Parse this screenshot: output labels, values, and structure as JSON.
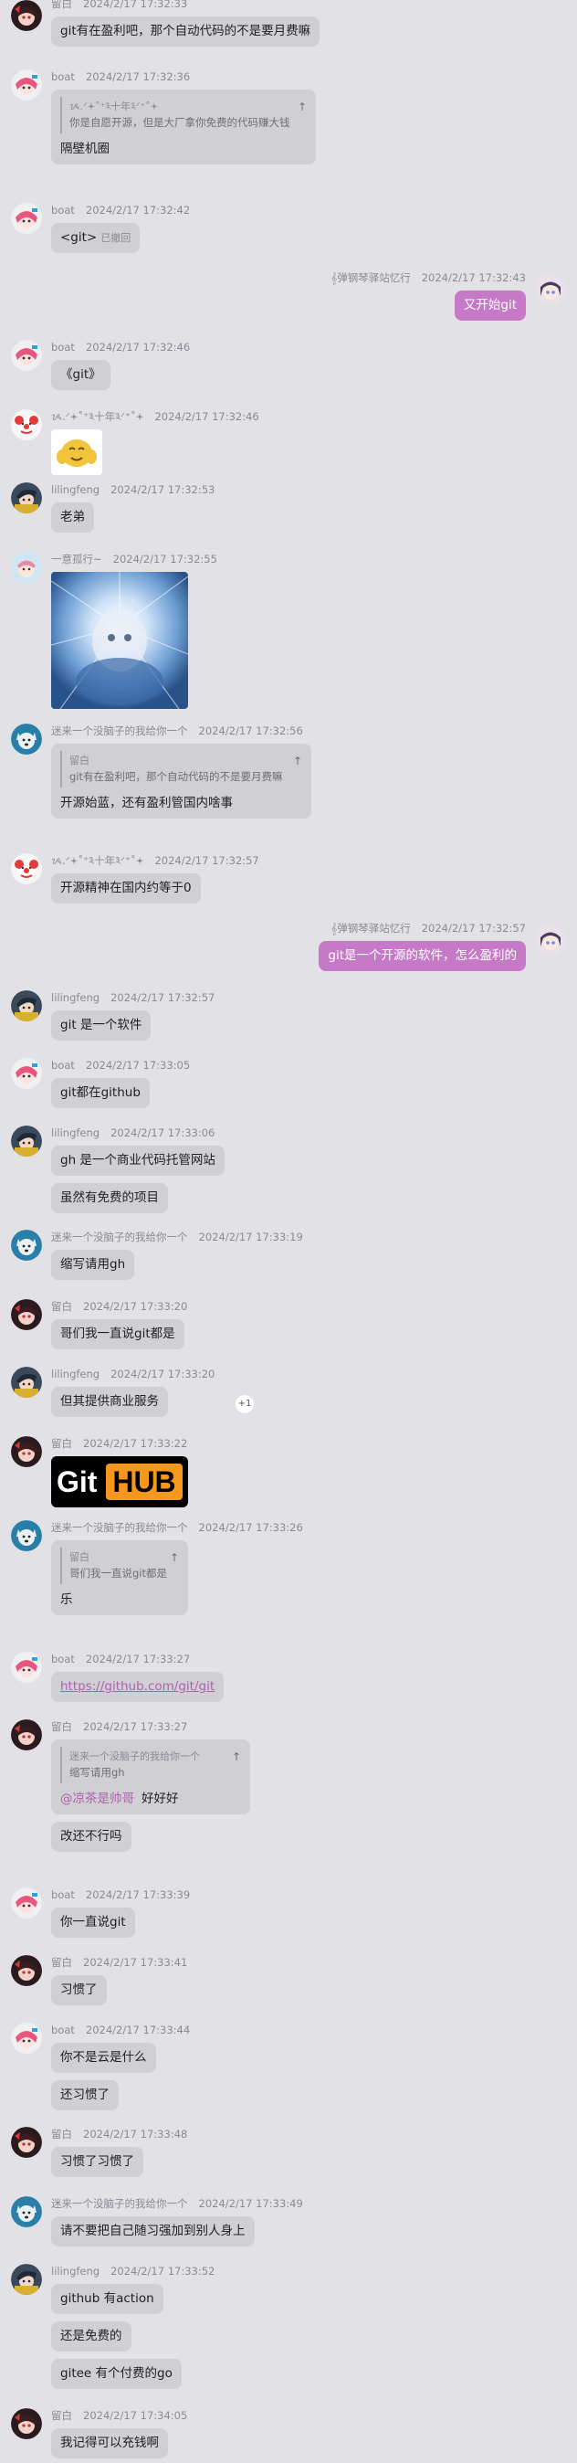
{
  "users": {
    "liubai": "留白",
    "boat": "boat",
    "moyan": "𝄞弹钢琴驿站忆行",
    "lilingfeng": "lilingfeng",
    "clown": "ᝰ.ᐟ𖥔˚⁺༣十年༣ᐟ⁺˚𖥔",
    "yichui": "一意孤行~",
    "dog": "迷来一个没脑子的我给你一个"
  },
  "messages": [
    {
      "user": "liubai",
      "time": "2024/2/17 17:32:33",
      "bubbles": [
        {
          "text": "git有在盈利吧，那个自动代码的不是要月费嘛"
        }
      ]
    },
    {
      "user": "boat",
      "time": "2024/2/17 17:32:36",
      "bubbles": [
        {
          "quote_name": "ᝰ.ᐟ𖥔˚⁺༣十年༣ᐟ⁺˚𖥔",
          "quote_text": "你是自愿开源，但是大厂拿你免费的代码赚大钱",
          "text": "隔壁机圈"
        }
      ]
    },
    {
      "user": "boat",
      "time": "2024/2/17 17:32:42",
      "bubbles": [
        {
          "text": "<git>",
          "recall": "已撤回"
        }
      ]
    },
    {
      "user": "moyan",
      "time": "2024/2/17 17:32:43",
      "bubbles": [
        {
          "text": "又开始git"
        }
      ]
    },
    {
      "user": "boat",
      "time": "2024/2/17 17:32:46",
      "bubbles": [
        {
          "text": "《git》"
        }
      ]
    },
    {
      "user": "clown",
      "time": "2024/2/17 17:32:46",
      "bubbles": []
    },
    {
      "user": "lilingfeng",
      "time": "2024/2/17 17:32:53",
      "bubbles": [
        {
          "text": "老弟"
        }
      ]
    },
    {
      "user": "yichui",
      "time": "2024/2/17 17:32:55",
      "bubbles": []
    },
    {
      "user": "dog",
      "time": "2024/2/17 17:32:56",
      "bubbles": [
        {
          "quote_name": "留白",
          "quote_text": "git有在盈利吧，那个自动代码的不是要月费嘛",
          "text": "开源始蓝，还有盈利管国内啥事"
        }
      ]
    },
    {
      "user": "clown",
      "time": "2024/2/17 17:32:57",
      "bubbles": [
        {
          "text": "开源精神在国内约等于0"
        }
      ]
    },
    {
      "user": "moyan",
      "time": "2024/2/17 17:32:57",
      "bubbles": [
        {
          "text": "git是一个开源的软件，怎么盈利的"
        }
      ]
    },
    {
      "user": "lilingfeng",
      "time": "2024/2/17 17:32:57",
      "bubbles": [
        {
          "text": "git 是一个软件"
        }
      ]
    },
    {
      "user": "boat",
      "time": "2024/2/17 17:33:05",
      "bubbles": [
        {
          "text": "git都在github"
        }
      ]
    },
    {
      "user": "lilingfeng",
      "time": "2024/2/17 17:33:06",
      "bubbles": [
        {
          "text": "gh 是一个商业代码托管网站"
        },
        {
          "text": "虽然有免费的项目"
        }
      ]
    },
    {
      "user": "dog",
      "time": "2024/2/17 17:33:19",
      "bubbles": [
        {
          "text": "缩写请用gh"
        }
      ]
    },
    {
      "user": "liubai",
      "time": "2024/2/17 17:33:20",
      "bubbles": [
        {
          "text": "哥们我一直说git都是"
        }
      ]
    },
    {
      "user": "lilingfeng",
      "time": "2024/2/17 17:33:20",
      "bubbles": [
        {
          "text": "但其提供商业服务",
          "plus": "+1"
        }
      ]
    },
    {
      "user": "liubai",
      "time": "2024/2/17 17:33:22",
      "bubbles": []
    },
    {
      "user": "dog",
      "time": "2024/2/17 17:33:26",
      "bubbles": [
        {
          "quote_name": "留白",
          "quote_text": "哥们我一直说git都是",
          "text": "乐"
        }
      ]
    },
    {
      "user": "boat",
      "time": "2024/2/17 17:33:27",
      "bubbles": [
        {
          "text": "https://github.com/git/git",
          "link": true
        }
      ]
    },
    {
      "user": "liubai",
      "time": "2024/2/17 17:33:27",
      "bubbles": [
        {
          "quote_name": "迷来一个没脑子的我给你一个",
          "quote_text": "缩写请用gh",
          "mention": "@凉茶是帅哥",
          "text": "好好好"
        },
        {
          "text": "改还不行吗"
        }
      ]
    },
    {
      "user": "boat",
      "time": "2024/2/17 17:33:39",
      "bubbles": [
        {
          "text": "你一直说git"
        }
      ]
    },
    {
      "user": "liubai",
      "time": "2024/2/17 17:33:41",
      "bubbles": [
        {
          "text": "习惯了"
        }
      ]
    },
    {
      "user": "boat",
      "time": "2024/2/17 17:33:44",
      "bubbles": [
        {
          "text": "你不是云是什么"
        },
        {
          "text": "还习惯了"
        }
      ]
    },
    {
      "user": "liubai",
      "time": "2024/2/17 17:33:48",
      "bubbles": [
        {
          "text": "习惯了习惯了"
        }
      ]
    },
    {
      "user": "dog",
      "time": "2024/2/17 17:33:49",
      "bubbles": [
        {
          "text": "请不要把自己随习强加到别人身上"
        }
      ]
    },
    {
      "user": "lilingfeng",
      "time": "2024/2/17 17:33:52",
      "bubbles": [
        {
          "text": "github 有action"
        },
        {
          "text": "还是免费的"
        },
        {
          "text": "gitee 有个付费的go"
        }
      ]
    },
    {
      "user": "liubai",
      "time": "2024/2/17 17:34:05",
      "bubbles": [
        {
          "text": "我记得可以充钱啊"
        }
      ]
    }
  ],
  "stickers": {
    "github_logo_left": "Git",
    "github_logo_right": "HUB"
  },
  "colors": {
    "background": "#e1e1e6",
    "bubble": "#cfcfd4",
    "self_bubble": "#c679c6",
    "accent": "#b061b0",
    "meta_text": "#8a8a92"
  },
  "icons": {
    "liubai": "girl-avatar-icon",
    "boat": "pink-girl-avatar-icon",
    "moyan": "anime-girl-avatar-icon",
    "lilingfeng": "boy-avatar-icon",
    "clown": "clown-avatar-icon",
    "yichui": "cartoon-avatar-icon",
    "dog": "dog-avatar-icon"
  }
}
